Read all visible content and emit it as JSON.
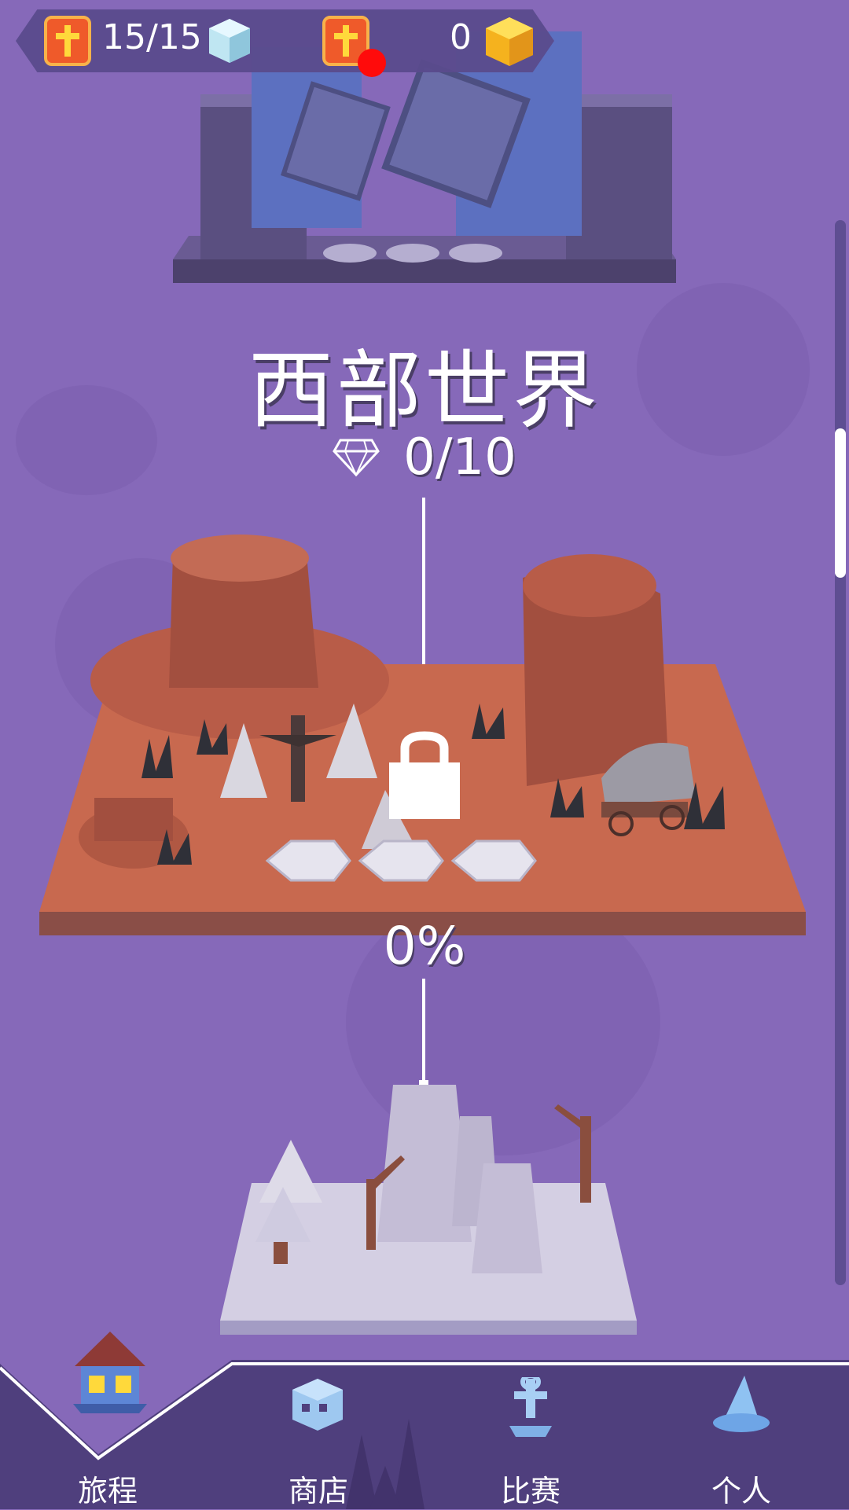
{
  "resources": {
    "lives": "15/15",
    "coins": "0"
  },
  "world": {
    "title": "西部世界",
    "gems": "0/10",
    "progress": "0%"
  },
  "nav": {
    "items": [
      {
        "label": "旅程",
        "icon": "house-icon",
        "active": true
      },
      {
        "label": "商店",
        "icon": "skull-cube-icon",
        "active": false
      },
      {
        "label": "比赛",
        "icon": "ankh-trophy-icon",
        "active": false
      },
      {
        "label": "个人",
        "icon": "wizard-hat-icon",
        "active": false
      }
    ]
  },
  "colors": {
    "background": "#8669b9",
    "desert": "#c86b52",
    "nav_bg": "#4f3f7d",
    "accent_orange": "#ef5a2a",
    "gold": "#f5c542"
  }
}
